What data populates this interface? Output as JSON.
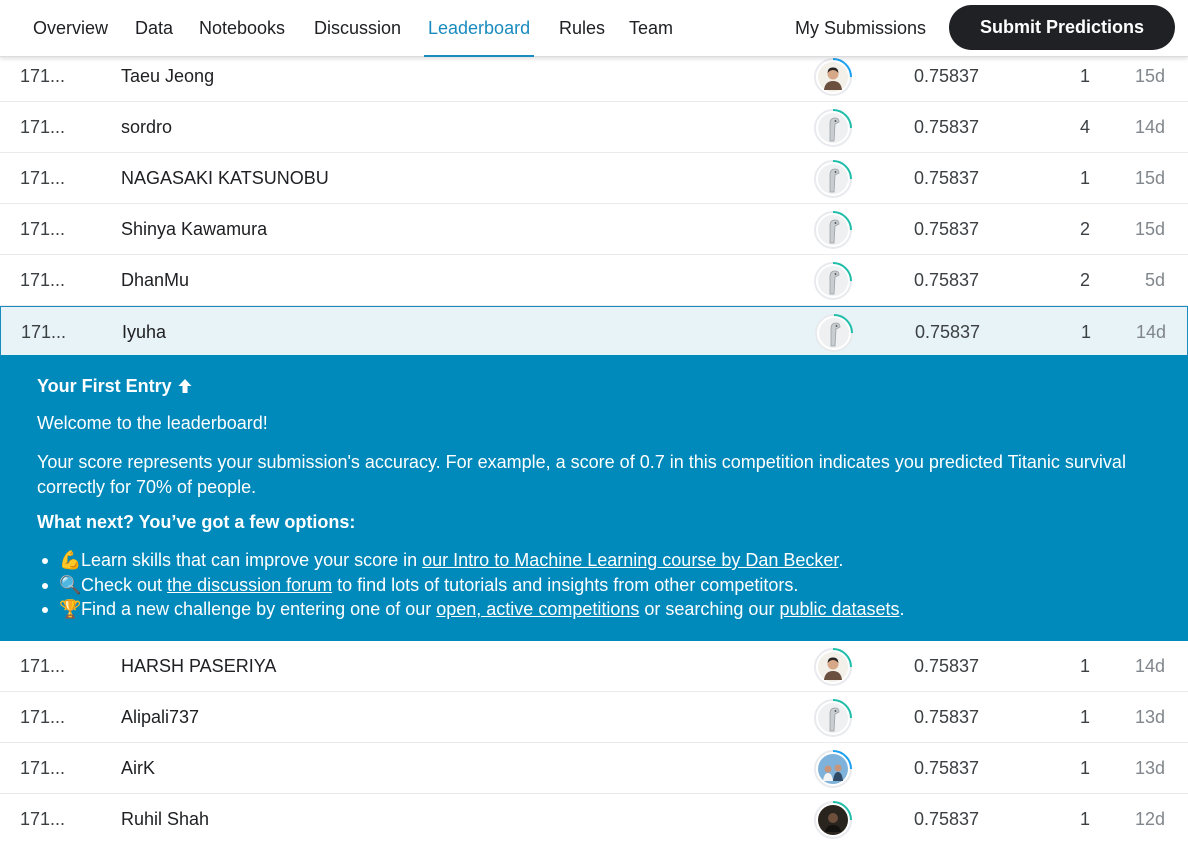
{
  "nav": {
    "tabs": [
      "Overview",
      "Data",
      "Notebooks",
      "Discussion",
      "Leaderboard",
      "Rules",
      "Team"
    ],
    "active_tab": "Leaderboard",
    "my_submissions": "My Submissions",
    "submit_button": "Submit Predictions"
  },
  "rows_top": [
    {
      "rank": "171...",
      "name": "Taeu Jeong",
      "score": "0.75837",
      "entries": "1",
      "last": "15d",
      "avatar": "photo-person"
    },
    {
      "rank": "171...",
      "name": "sordro",
      "score": "0.75837",
      "entries": "4",
      "last": "14d",
      "avatar": "default-bird"
    },
    {
      "rank": "171...",
      "name": "NAGASAKI KATSUNOBU",
      "score": "0.75837",
      "entries": "1",
      "last": "15d",
      "avatar": "default-bird"
    },
    {
      "rank": "171...",
      "name": "Shinya Kawamura",
      "score": "0.75837",
      "entries": "2",
      "last": "15d",
      "avatar": "default-bird"
    },
    {
      "rank": "171...",
      "name": "DhanMu",
      "score": "0.75837",
      "entries": "2",
      "last": "5d",
      "avatar": "default-bird"
    },
    {
      "rank": "171...",
      "name": "Iyuha",
      "score": "0.75837",
      "entries": "1",
      "last": "14d",
      "avatar": "default-bird"
    }
  ],
  "first_entry": {
    "title": "Your First Entry",
    "welcome": "Welcome to the leaderboard!",
    "score_text": "Your score represents your submission's accuracy. For example, a score of 0.7 in this competition indicates you predicted Titanic survival correctly for 70% of people.",
    "next_title": "What next? You’ve got a few options:",
    "items": [
      {
        "emoji": "💪",
        "pre": "Learn skills that can improve your score in ",
        "link": "our Intro to Machine Learning course by Dan Becker",
        "post": "."
      },
      {
        "emoji": "🔍",
        "pre": "Check out ",
        "link": "the discussion forum",
        "post": " to find lots of tutorials and insights from other competitors."
      },
      {
        "emoji": "🏆",
        "pre": "Find a new challenge by entering one of our ",
        "link": "open, active competitions",
        "mid": " or searching our ",
        "link2": "public datasets",
        "post": "."
      }
    ]
  },
  "rows_bottom": [
    {
      "rank": "171...",
      "name": "HARSH PASERIYA",
      "score": "0.75837",
      "entries": "1",
      "last": "14d",
      "avatar": "photo-person"
    },
    {
      "rank": "171...",
      "name": "Alipali737",
      "score": "0.75837",
      "entries": "1",
      "last": "13d",
      "avatar": "default-bird"
    },
    {
      "rank": "171...",
      "name": "AirK",
      "score": "0.75837",
      "entries": "1",
      "last": "13d",
      "avatar": "photo-group"
    },
    {
      "rank": "171...",
      "name": "Ruhil Shah",
      "score": "0.75837",
      "entries": "1",
      "last": "12d",
      "avatar": "photo-dark"
    }
  ],
  "colors": {
    "accent": "#1a8bbf",
    "panel": "#008abc",
    "ring_green": "#20beaa",
    "ring_blue": "#1da1f2"
  }
}
